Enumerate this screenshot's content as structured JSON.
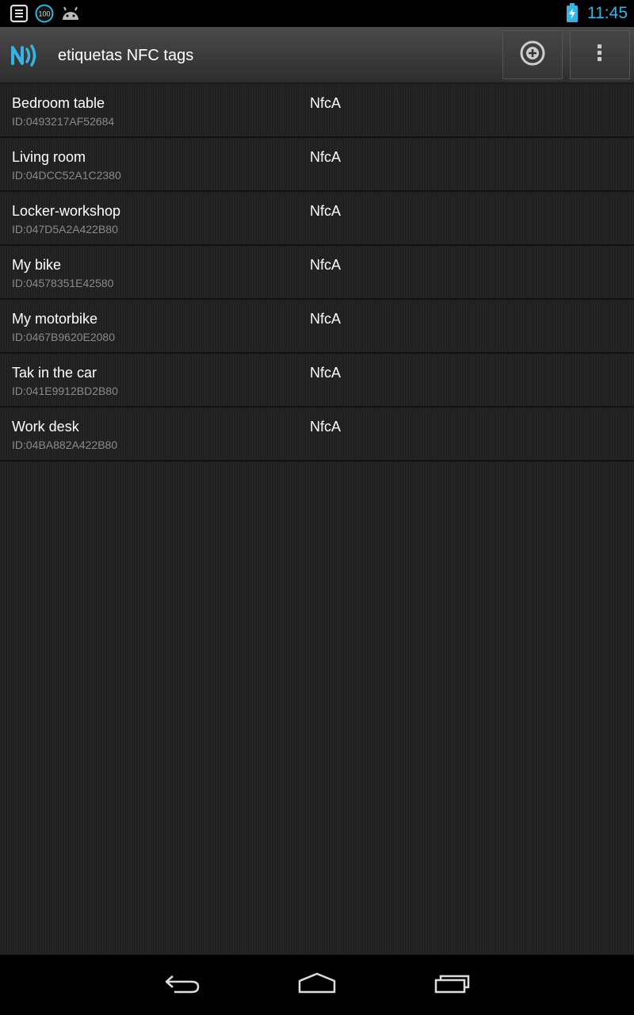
{
  "status_bar": {
    "time": "11:45",
    "icons": [
      "notes-notification-icon",
      "battery-100-notification-icon",
      "android-notification-icon",
      "battery-charging-icon"
    ],
    "notification_badge": "100",
    "accent_color": "#33b5e5"
  },
  "action_bar": {
    "title": "etiquetas NFC tags",
    "app_icon": "nfc-logo-icon",
    "actions": [
      {
        "name": "add-tag",
        "icon": "add-circle-icon"
      },
      {
        "name": "overflow-menu",
        "icon": "more-vertical-icon"
      }
    ]
  },
  "tags": [
    {
      "name": "Bedroom table",
      "id": "ID:0493217AF52684",
      "type": "NfcA"
    },
    {
      "name": "Living room",
      "id": "ID:04DCC52A1C2380",
      "type": "NfcA"
    },
    {
      "name": "Locker-workshop",
      "id": "ID:047D5A2A422B80",
      "type": "NfcA"
    },
    {
      "name": "My bike",
      "id": "ID:04578351E42580",
      "type": "NfcA"
    },
    {
      "name": "My motorbike",
      "id": "ID:0467B9620E2080",
      "type": "NfcA"
    },
    {
      "name": "Tak in the car",
      "id": "ID:041E9912BD2B80",
      "type": "NfcA"
    },
    {
      "name": "Work desk",
      "id": "ID:04BA882A422B80",
      "type": "NfcA"
    }
  ],
  "nav_bar": {
    "buttons": [
      "back-icon",
      "home-icon",
      "recent-apps-icon"
    ]
  }
}
